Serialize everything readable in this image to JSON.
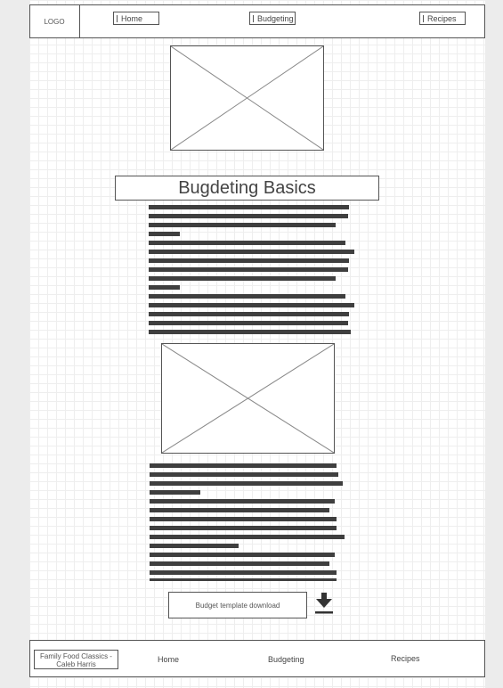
{
  "header": {
    "logo": "LOGO",
    "nav": [
      {
        "label": "Home"
      },
      {
        "label": "Budgeting"
      },
      {
        "label": "Recipes"
      }
    ]
  },
  "article": {
    "title": "Bugdeting Basics",
    "download_label": "Budget template download",
    "download_icon": "download-arrow-icon"
  },
  "footer": {
    "brand_line1": "Family Food Classics -",
    "brand_line2": "Caleb Harris",
    "links": [
      {
        "label": "Home"
      },
      {
        "label": "Budgeting"
      },
      {
        "label": "Recipes"
      }
    ]
  },
  "colors": {
    "wire_stroke": "#555555",
    "text_bar": "#3f3f3f",
    "grid": "#eeeeee"
  }
}
